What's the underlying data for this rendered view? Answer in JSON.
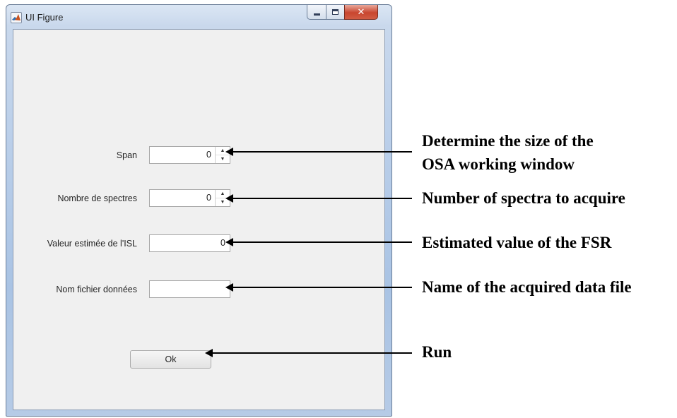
{
  "window": {
    "title": "UI Figure",
    "minimize_icon": "minimize-icon",
    "maximize_icon": "maximize-icon",
    "close_icon": "close-icon",
    "close_glyph": "✕",
    "close_color": "#c8462f"
  },
  "form": {
    "fields": [
      {
        "label": "Span",
        "value": "0"
      },
      {
        "label": "Nombre de spectres",
        "value": "0"
      },
      {
        "label": "Valeur estimée de l'ISL",
        "value": "0"
      },
      {
        "label": "Nom fichier données",
        "value": ""
      }
    ],
    "spinner_up_glyph": "▲",
    "spinner_down_glyph": "▼",
    "ok_label": "Ok"
  },
  "annotations": [
    {
      "line1": "Determine the size of the",
      "line2": "OSA working window"
    },
    {
      "text": "Number of spectra to acquire"
    },
    {
      "text": "Estimated value of the FSR"
    },
    {
      "text": "Name of the acquired data file"
    },
    {
      "text": "Run"
    }
  ]
}
